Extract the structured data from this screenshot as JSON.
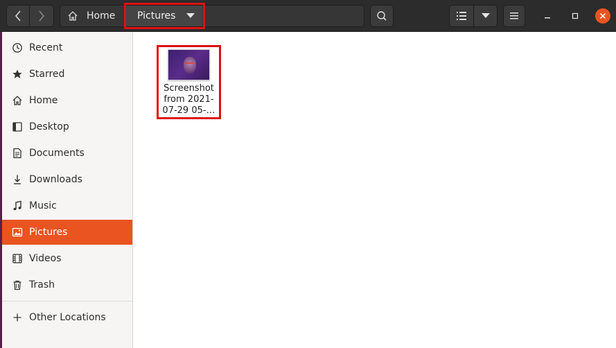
{
  "header": {
    "breadcrumb": {
      "home_label": "Home",
      "current_label": "Pictures"
    }
  },
  "sidebar": {
    "items": [
      {
        "label": "Recent",
        "icon": "clock-icon"
      },
      {
        "label": "Starred",
        "icon": "star-icon"
      },
      {
        "label": "Home",
        "icon": "home-icon"
      },
      {
        "label": "Desktop",
        "icon": "desktop-icon"
      },
      {
        "label": "Documents",
        "icon": "document-icon"
      },
      {
        "label": "Downloads",
        "icon": "download-icon"
      },
      {
        "label": "Music",
        "icon": "music-icon"
      },
      {
        "label": "Pictures",
        "icon": "image-icon",
        "active": true
      },
      {
        "label": "Videos",
        "icon": "video-icon"
      },
      {
        "label": "Trash",
        "icon": "trash-icon"
      }
    ],
    "other_locations": "Other Locations"
  },
  "files": [
    {
      "name_lines": [
        "Screenshot",
        "from 2021-",
        "07-29 05-…"
      ]
    }
  ],
  "colors": {
    "accent": "#e95420",
    "highlight": "#e01010",
    "headerbar": "#2c2c2c"
  }
}
